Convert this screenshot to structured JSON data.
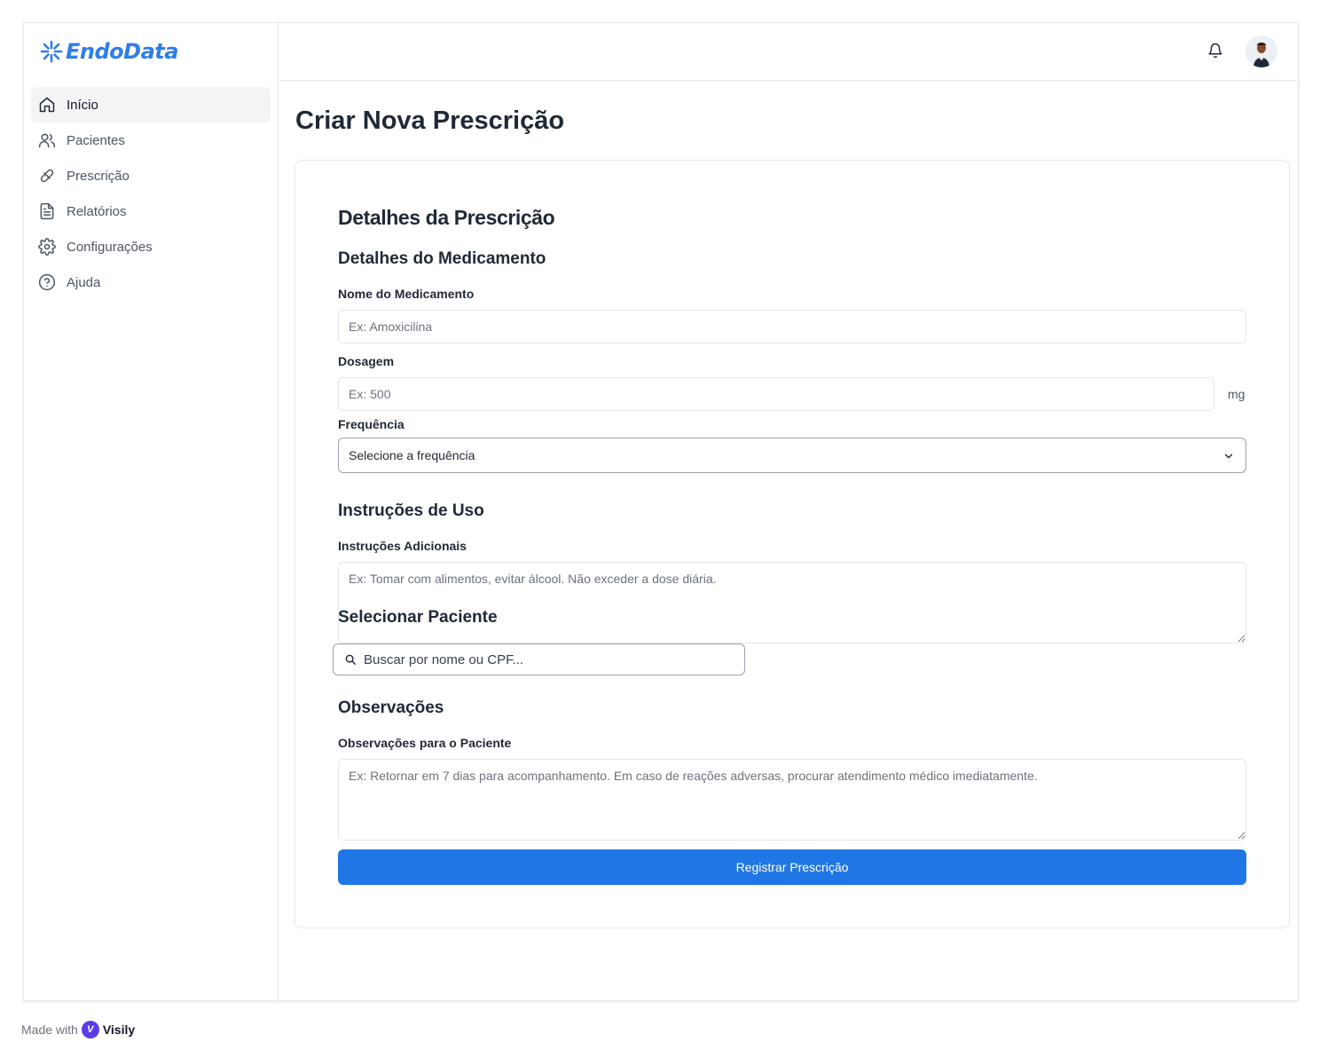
{
  "app": {
    "name": "EndoData",
    "brand_color": "#2f7ee8"
  },
  "sidebar": {
    "items": [
      {
        "label": "Início",
        "icon": "home-icon",
        "active": true
      },
      {
        "label": "Pacientes",
        "icon": "users-icon"
      },
      {
        "label": "Prescrição",
        "icon": "pill-icon"
      },
      {
        "label": "Relatórios",
        "icon": "file-text-icon"
      },
      {
        "label": "Configurações",
        "icon": "gear-icon"
      },
      {
        "label": "Ajuda",
        "icon": "help-circle-icon"
      }
    ]
  },
  "header": {
    "notifications_icon": "bell-icon",
    "avatar": "user-avatar"
  },
  "page": {
    "title": "Criar Nova Prescrição"
  },
  "form": {
    "title": "Detalhes da Prescrição",
    "medication_section": "Detalhes do Medicamento",
    "medication_name_label": "Nome do Medicamento",
    "medication_name_placeholder": "Ex: Amoxicilina",
    "dosage_label": "Dosagem",
    "dosage_placeholder": "Ex: 500",
    "dosage_unit": "mg",
    "frequency_label": "Frequência",
    "frequency_value": "Selecione a frequência",
    "instructions_section": "Instruções de Uso",
    "instructions_label": "Instruções Adicionais",
    "instructions_placeholder": "Ex: Tomar com alimentos, evitar álcool. Não exceder a dose diária.",
    "patient_section": "Selecionar Paciente",
    "patient_search_placeholder": "Buscar por nome ou CPF...",
    "notes_section": "Observações",
    "notes_label": "Observações para o Paciente",
    "notes_placeholder": "Ex: Retornar em 7 dias para acompanhamento. Em caso de reações adversas, procurar atendimento médico imediatamente.",
    "submit_label": "Registrar Prescrição",
    "submit_color": "#2176e5"
  },
  "footer": {
    "made_with": "Made with",
    "brand": "Visily"
  }
}
